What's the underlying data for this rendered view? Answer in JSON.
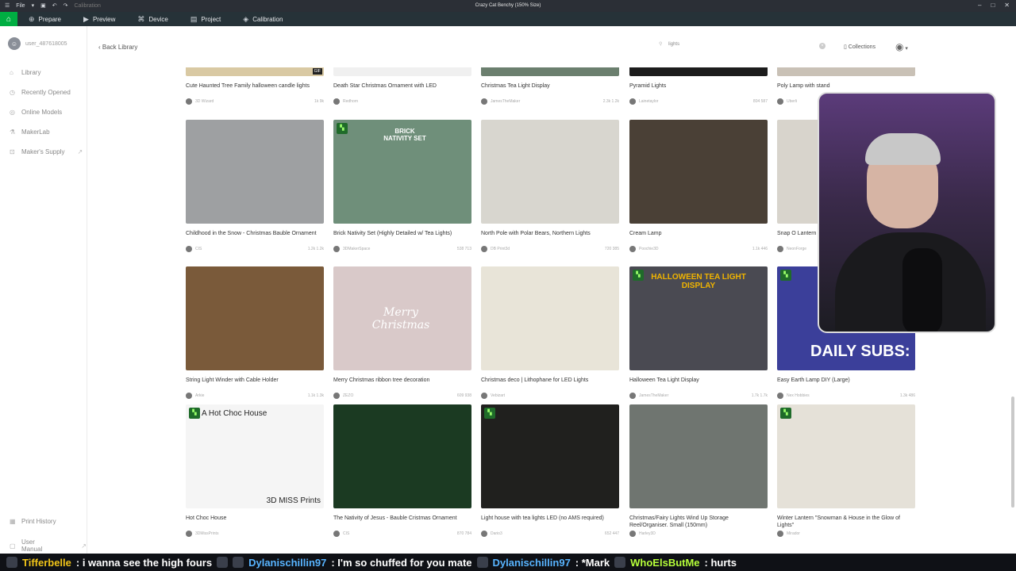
{
  "titlebar": {
    "file_label": "File",
    "calibration_small": "Calibration",
    "window_title": "Crazy Cat Benchy (150% Size)"
  },
  "menu": {
    "tabs": [
      "Prepare",
      "Preview",
      "Device",
      "Project",
      "Calibration"
    ]
  },
  "sidebar": {
    "username": "user_487618005",
    "items": [
      "Library",
      "Recently Opened",
      "Online Models",
      "MakerLab",
      "Maker's Supply"
    ],
    "bottom": [
      "Print History",
      "User Manual"
    ]
  },
  "topbar": {
    "back_label": "Back Library",
    "search_value": "lights",
    "collections_label": "Collections"
  },
  "cards": [
    {
      "title": "Cute Haunted Tree Family halloween candle lights",
      "author": "3D Wizard",
      "stats": "1k  9k",
      "bg": "#d9c9a3"
    },
    {
      "title": "Death Star Christmas Ornament with LED",
      "author": "Redhorn",
      "stats": "",
      "bg": "#f0f0f0"
    },
    {
      "title": "Christmas Tea Light Display",
      "author": "JamesTheMaker",
      "stats": "2.3k  1.2k",
      "bg": "#6b7f6e"
    },
    {
      "title": "Pyramid Lights",
      "author": "Lainetaylor",
      "stats": "804  587",
      "bg": "#1c1c1c"
    },
    {
      "title": "Poly Lamp with stand",
      "author": "Uberli",
      "stats": "",
      "bg": "#c9c1b6"
    },
    {
      "title": "Childhood in the Snow - Christmas Bauble Ornament",
      "author": "CIS",
      "stats": "1.2k  1.2k",
      "bg": "#9ea0a2"
    },
    {
      "title": "Brick Nativity Set (Highly Detailed w/ Tea Lights)",
      "author": "3DMakerSpace",
      "stats": "538  713",
      "bg": "#6f8f7a"
    },
    {
      "title": "North Pole with Polar Bears, Northern Lights",
      "author": "DB Print3d",
      "stats": "720  385",
      "bg": "#d8d6cf"
    },
    {
      "title": "Cream Lamp",
      "author": "Poochie3D",
      "stats": "1.1k  446",
      "bg": "#4a4036"
    },
    {
      "title": "Snap O Lantern",
      "author": "NeonForge",
      "stats": "",
      "bg": "#d8d4cc"
    },
    {
      "title": "String Light Winder with Cable Holder",
      "author": "Arkie",
      "stats": "1.1k  1.3k",
      "bg": "#7a5a3a"
    },
    {
      "title": "Merry Christmas ribbon tree decoration",
      "author": "ZEZO",
      "stats": "609  938",
      "bg": "#d9c9c9"
    },
    {
      "title": "Christmas deco | Lithophane for LED Lights",
      "author": "Vebizart",
      "stats": "",
      "bg": "#e8e4d8"
    },
    {
      "title": "Halloween Tea Light Display",
      "author": "JamesTheMaker",
      "stats": "1.7k  1.7k",
      "bg": "#4a4a52"
    },
    {
      "title": "Easy Earth Lamp DIY (Large)",
      "author": "Nex Hobbies",
      "stats": "1.3k  486",
      "bg": "#3b3f9a"
    },
    {
      "title": "Hot Choc House",
      "author": "3DMissPrints",
      "stats": "",
      "bg": "#f5f5f5"
    },
    {
      "title": "The Nativity of Jesus - Bauble Cristmas Ornament",
      "author": "CIS",
      "stats": "870  784",
      "bg": "#1b3a22"
    },
    {
      "title": "Light house with tea lights LED (no AMS required)",
      "author": "Dario3",
      "stats": "652  447",
      "bg": "#20201e"
    },
    {
      "title": "Christmas/Fairy Lights Wind Up Storage Reel/Organiser. Small (150mm)",
      "author": "Harley3D",
      "stats": "",
      "bg": "#6f7570"
    },
    {
      "title": "Winter Lantern \"Snowman & House in the Glow of Lights\"",
      "author": "Mirador",
      "stats": "",
      "bg": "#e5e1d8"
    }
  ],
  "overlay_text": {
    "daily_subs": "DAILY SUBS:",
    "thumb_brick": "BRICK NATIVITY SET",
    "thumb_halloween": "HALLOWEEN TEA LIGHT DISPLAY",
    "thumb_hotchoc": "A Hot Choc House",
    "thumb_missprints": "3D MISS Prints",
    "thumb_merry": "Merry Christmas",
    "gif": "GIF"
  },
  "ticker": {
    "name1": "Tifferbelle",
    "msg1": ": i wanna see the high fours",
    "name2": "Dylanischillin97",
    "msg2": ": I'm so chuffed for you mate",
    "name3": "Dylanischillin97",
    "msg3": ": *Mark",
    "name4": "WhoElsButMe",
    "msg4": ": hurts"
  }
}
